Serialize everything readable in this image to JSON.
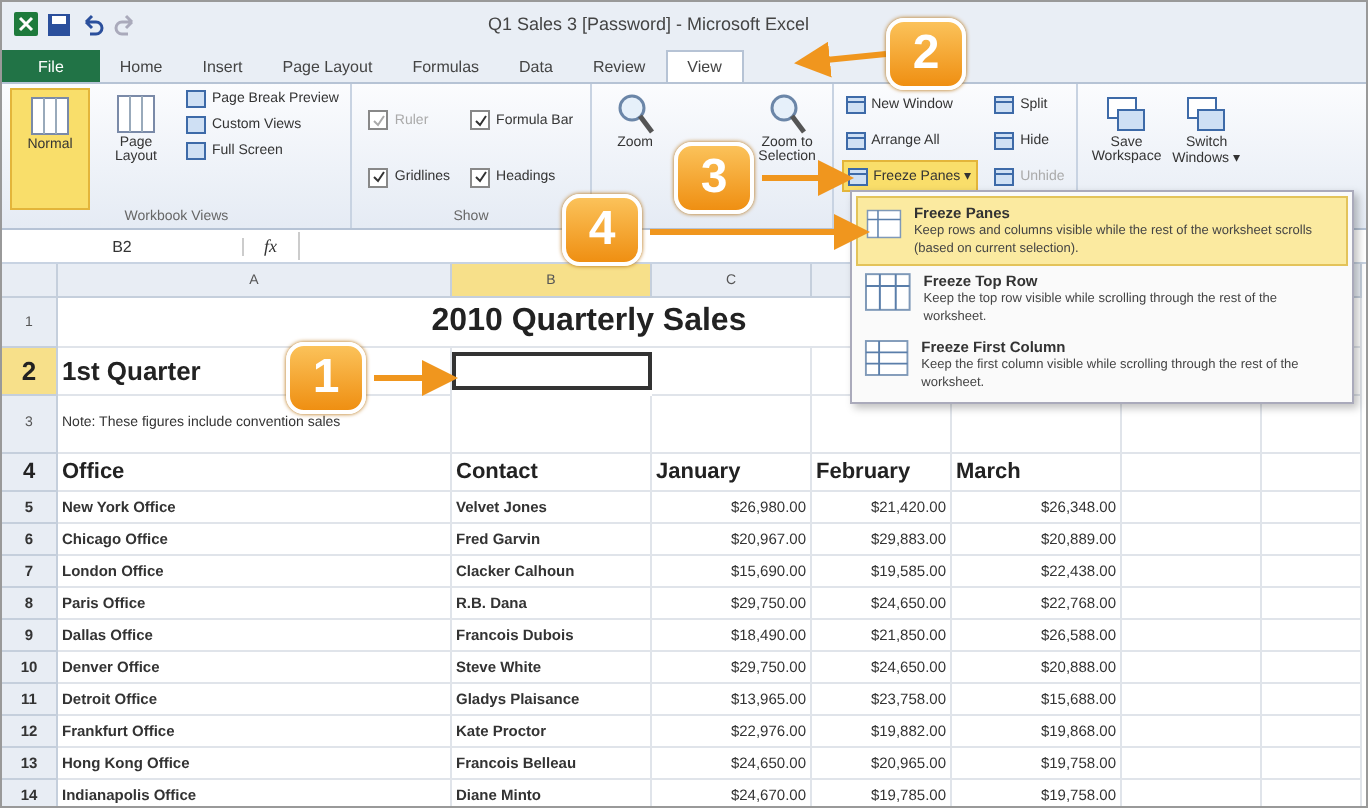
{
  "window": {
    "title": "Q1 Sales 3 [Password] - Microsoft Excel"
  },
  "tabs": [
    {
      "label": "File",
      "kind": "file",
      "selected": false
    },
    {
      "label": "Home",
      "kind": "tab",
      "selected": false
    },
    {
      "label": "Insert",
      "kind": "tab",
      "selected": false
    },
    {
      "label": "Page Layout",
      "kind": "tab",
      "selected": false
    },
    {
      "label": "Formulas",
      "kind": "tab",
      "selected": false
    },
    {
      "label": "Data",
      "kind": "tab",
      "selected": false
    },
    {
      "label": "Review",
      "kind": "tab",
      "selected": false
    },
    {
      "label": "View",
      "kind": "tab",
      "selected": true
    }
  ],
  "ribbon": {
    "views": [
      {
        "label": "Normal",
        "selected": true
      },
      {
        "label": "Page Layout",
        "selected": false
      }
    ],
    "view_links": [
      "Page Break Preview",
      "Custom Views",
      "Full Screen"
    ],
    "views_group": "Workbook Views",
    "show": [
      {
        "label": "Ruler",
        "checked": true,
        "disabled": true
      },
      {
        "label": "Formula Bar",
        "checked": true,
        "disabled": false
      },
      {
        "label": "Gridlines",
        "checked": true,
        "disabled": false
      },
      {
        "label": "Headings",
        "checked": true,
        "disabled": false
      }
    ],
    "show_group": "Show",
    "zoom": [
      {
        "label": "Zoom"
      },
      {
        "label": "Zoom to Selection"
      }
    ],
    "window_cmds": [
      {
        "label": "New Window",
        "disabled": false
      },
      {
        "label": "Arrange All",
        "disabled": false
      },
      {
        "label": "Freeze Panes ▾",
        "disabled": false
      },
      {
        "label": "Split",
        "disabled": false
      },
      {
        "label": "Hide",
        "disabled": false
      },
      {
        "label": "Unhide",
        "disabled": true
      }
    ],
    "workspace": [
      {
        "label": "Save Workspace"
      },
      {
        "label": "Switch Windows ▾"
      }
    ]
  },
  "formula_bar": {
    "name_box": "B2",
    "fx": "fx"
  },
  "freeze_menu": [
    {
      "title": "Freeze Panes",
      "description": "Keep rows and columns visible while the rest of the worksheet scrolls (based on current selection).",
      "selected": true
    },
    {
      "title": "Freeze Top Row",
      "description": "Keep the top row visible while scrolling through the rest of the worksheet.",
      "selected": false
    },
    {
      "title": "Freeze First Column",
      "description": "Keep the first column visible while scrolling through the rest of the worksheet.",
      "selected": false
    }
  ],
  "columns": [
    {
      "label": "A",
      "selected": false
    },
    {
      "label": "B",
      "selected": true
    },
    {
      "label": "C",
      "selected": false
    }
  ],
  "rows": [
    {
      "number": "1",
      "kind": "title",
      "selected": false,
      "cells": [
        "2010 Quarterly Sales"
      ]
    },
    {
      "number": "2",
      "kind": "quarter",
      "selected": true,
      "cells": [
        "1st Quarter"
      ]
    },
    {
      "number": "3",
      "kind": "note",
      "selected": false,
      "cells": [
        "Note: These figures include convention sales"
      ]
    },
    {
      "number": "4",
      "kind": "header",
      "selected": false,
      "cells": [
        "Office",
        "Contact",
        "January",
        "February",
        "March"
      ]
    },
    {
      "number": "5",
      "kind": "data",
      "selected": false,
      "cells": [
        "New York Office",
        "Velvet Jones",
        "$26,980.00",
        "$21,420.00",
        "$26,348.00"
      ]
    },
    {
      "number": "6",
      "kind": "data",
      "selected": false,
      "cells": [
        "Chicago Office",
        "Fred Garvin",
        "$20,967.00",
        "$29,883.00",
        "$20,889.00"
      ]
    },
    {
      "number": "7",
      "kind": "data",
      "selected": false,
      "cells": [
        "London Office",
        "Clacker Calhoun",
        "$15,690.00",
        "$19,585.00",
        "$22,438.00"
      ]
    },
    {
      "number": "8",
      "kind": "data",
      "selected": false,
      "cells": [
        "Paris Office",
        "R.B. Dana",
        "$29,750.00",
        "$24,650.00",
        "$22,768.00"
      ]
    },
    {
      "number": "9",
      "kind": "data",
      "selected": false,
      "cells": [
        "Dallas Office",
        "Francois Dubois",
        "$18,490.00",
        "$21,850.00",
        "$26,588.00"
      ]
    },
    {
      "number": "10",
      "kind": "data",
      "selected": false,
      "cells": [
        "Denver Office",
        "Steve White",
        "$29,750.00",
        "$24,650.00",
        "$20,888.00"
      ]
    },
    {
      "number": "11",
      "kind": "data",
      "selected": false,
      "cells": [
        "Detroit Office",
        "Gladys Plaisance",
        "$13,965.00",
        "$23,758.00",
        "$15,688.00"
      ]
    },
    {
      "number": "12",
      "kind": "data",
      "selected": false,
      "cells": [
        "Frankfurt Office",
        "Kate Proctor",
        "$22,976.00",
        "$19,882.00",
        "$19,868.00"
      ]
    },
    {
      "number": "13",
      "kind": "data",
      "selected": false,
      "cells": [
        "Hong Kong Office",
        "Francois Belleau",
        "$24,650.00",
        "$20,965.00",
        "$19,758.00"
      ]
    },
    {
      "number": "14",
      "kind": "data",
      "selected": false,
      "cells": [
        "Indianapolis Office",
        "Diane Minto",
        "$24,670.00",
        "$19,785.00",
        "$19,758.00"
      ]
    }
  ],
  "callouts": [
    "1",
    "2",
    "3",
    "4"
  ]
}
